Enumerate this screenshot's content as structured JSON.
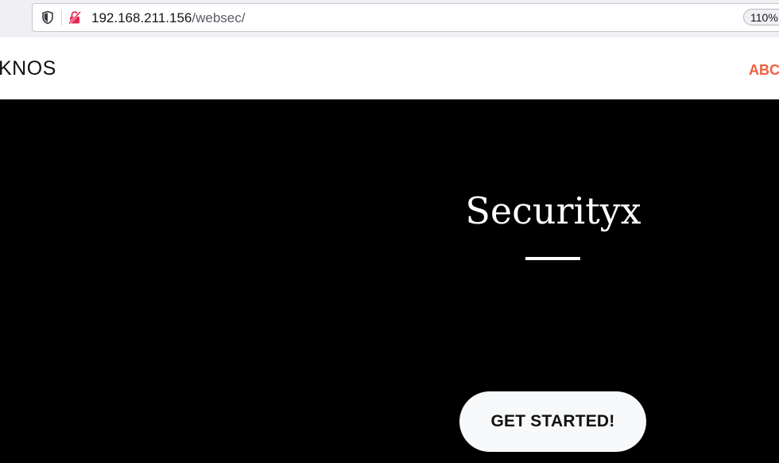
{
  "browser": {
    "url_host": "192.168.211.156",
    "url_path": "/websec/",
    "zoom": "110%"
  },
  "nav": {
    "brand": "KNOS",
    "link_about": "ABC"
  },
  "hero": {
    "title": "Securityx",
    "cta_label": "GET STARTED!"
  },
  "icons": {
    "shield": "shield-icon",
    "insecure_lock": "insecure-lock-icon"
  },
  "colors": {
    "accent": "#f05f40",
    "hero_bg": "#000000",
    "button_bg": "#f8f9fa",
    "insecure_icon": "#e22850"
  }
}
